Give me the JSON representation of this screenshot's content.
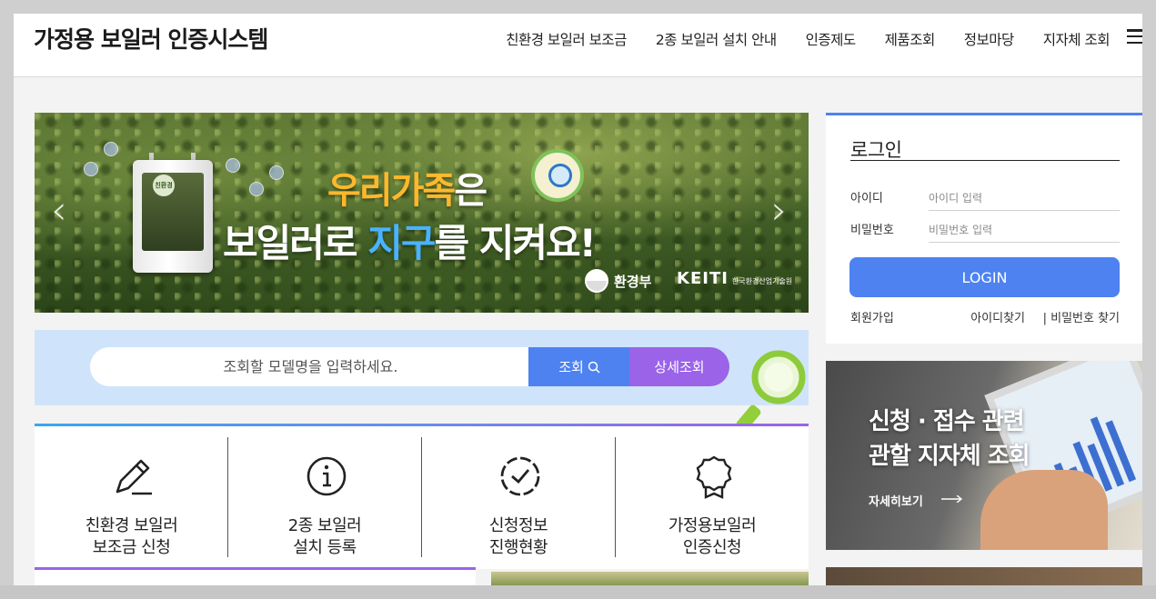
{
  "header": {
    "logo": "가정용 보일러 인증시스템",
    "nav": [
      "친환경 보일러 보조금",
      "2종 보일러 설치 안내",
      "인증제도",
      "제품조회",
      "정보마당",
      "지자체 조회"
    ]
  },
  "banner": {
    "boiler_badge": "친환경",
    "slogan_line1_highlight": "우리가족",
    "slogan_line1_rest": "은",
    "slogan_line2_a": "보일러로 ",
    "slogan_line2_highlight": "지구",
    "slogan_line2_b": "를 지켜요!",
    "ministry": "환경부",
    "keiti": "KEITI",
    "keiti_sub": "한국환경산업기술원",
    "prev_arrow": "‹",
    "next_arrow": "›"
  },
  "search": {
    "placeholder": "조회할 모델명을 입력하세요.",
    "search_label": "조회",
    "detail_label": "상세조회"
  },
  "quick_menu": [
    {
      "line1": "친환경 보일러",
      "line2": "보조금 신청",
      "icon": "pencil-icon"
    },
    {
      "line1": "2종 보일러",
      "line2": "설치 등록",
      "icon": "info-icon"
    },
    {
      "line1": "신청정보",
      "line2": "진행현황",
      "icon": "check-circle-icon"
    },
    {
      "line1": "가정용보일러",
      "line2": "인증신청",
      "icon": "award-icon"
    }
  ],
  "login": {
    "title": "로그인",
    "id_label": "아이디",
    "id_placeholder": "아이디 입력",
    "pw_label": "비밀번호",
    "pw_placeholder": "비밀번호 입력",
    "login_button": "LOGIN",
    "signup": "회원가입",
    "find_id": "아이디찾기",
    "find_pw": "| 비밀번호 찾기"
  },
  "promo": {
    "line1": "신청 · 접수 관련",
    "line2": "관할 지자체 조회",
    "more": "자세히보기"
  },
  "colors": {
    "primary": "#4d82f0",
    "purple": "#9b63e8",
    "search_bg": "#cfe4fb",
    "accent_yellow": "#ffb82c",
    "accent_blue": "#4ab3ff"
  }
}
